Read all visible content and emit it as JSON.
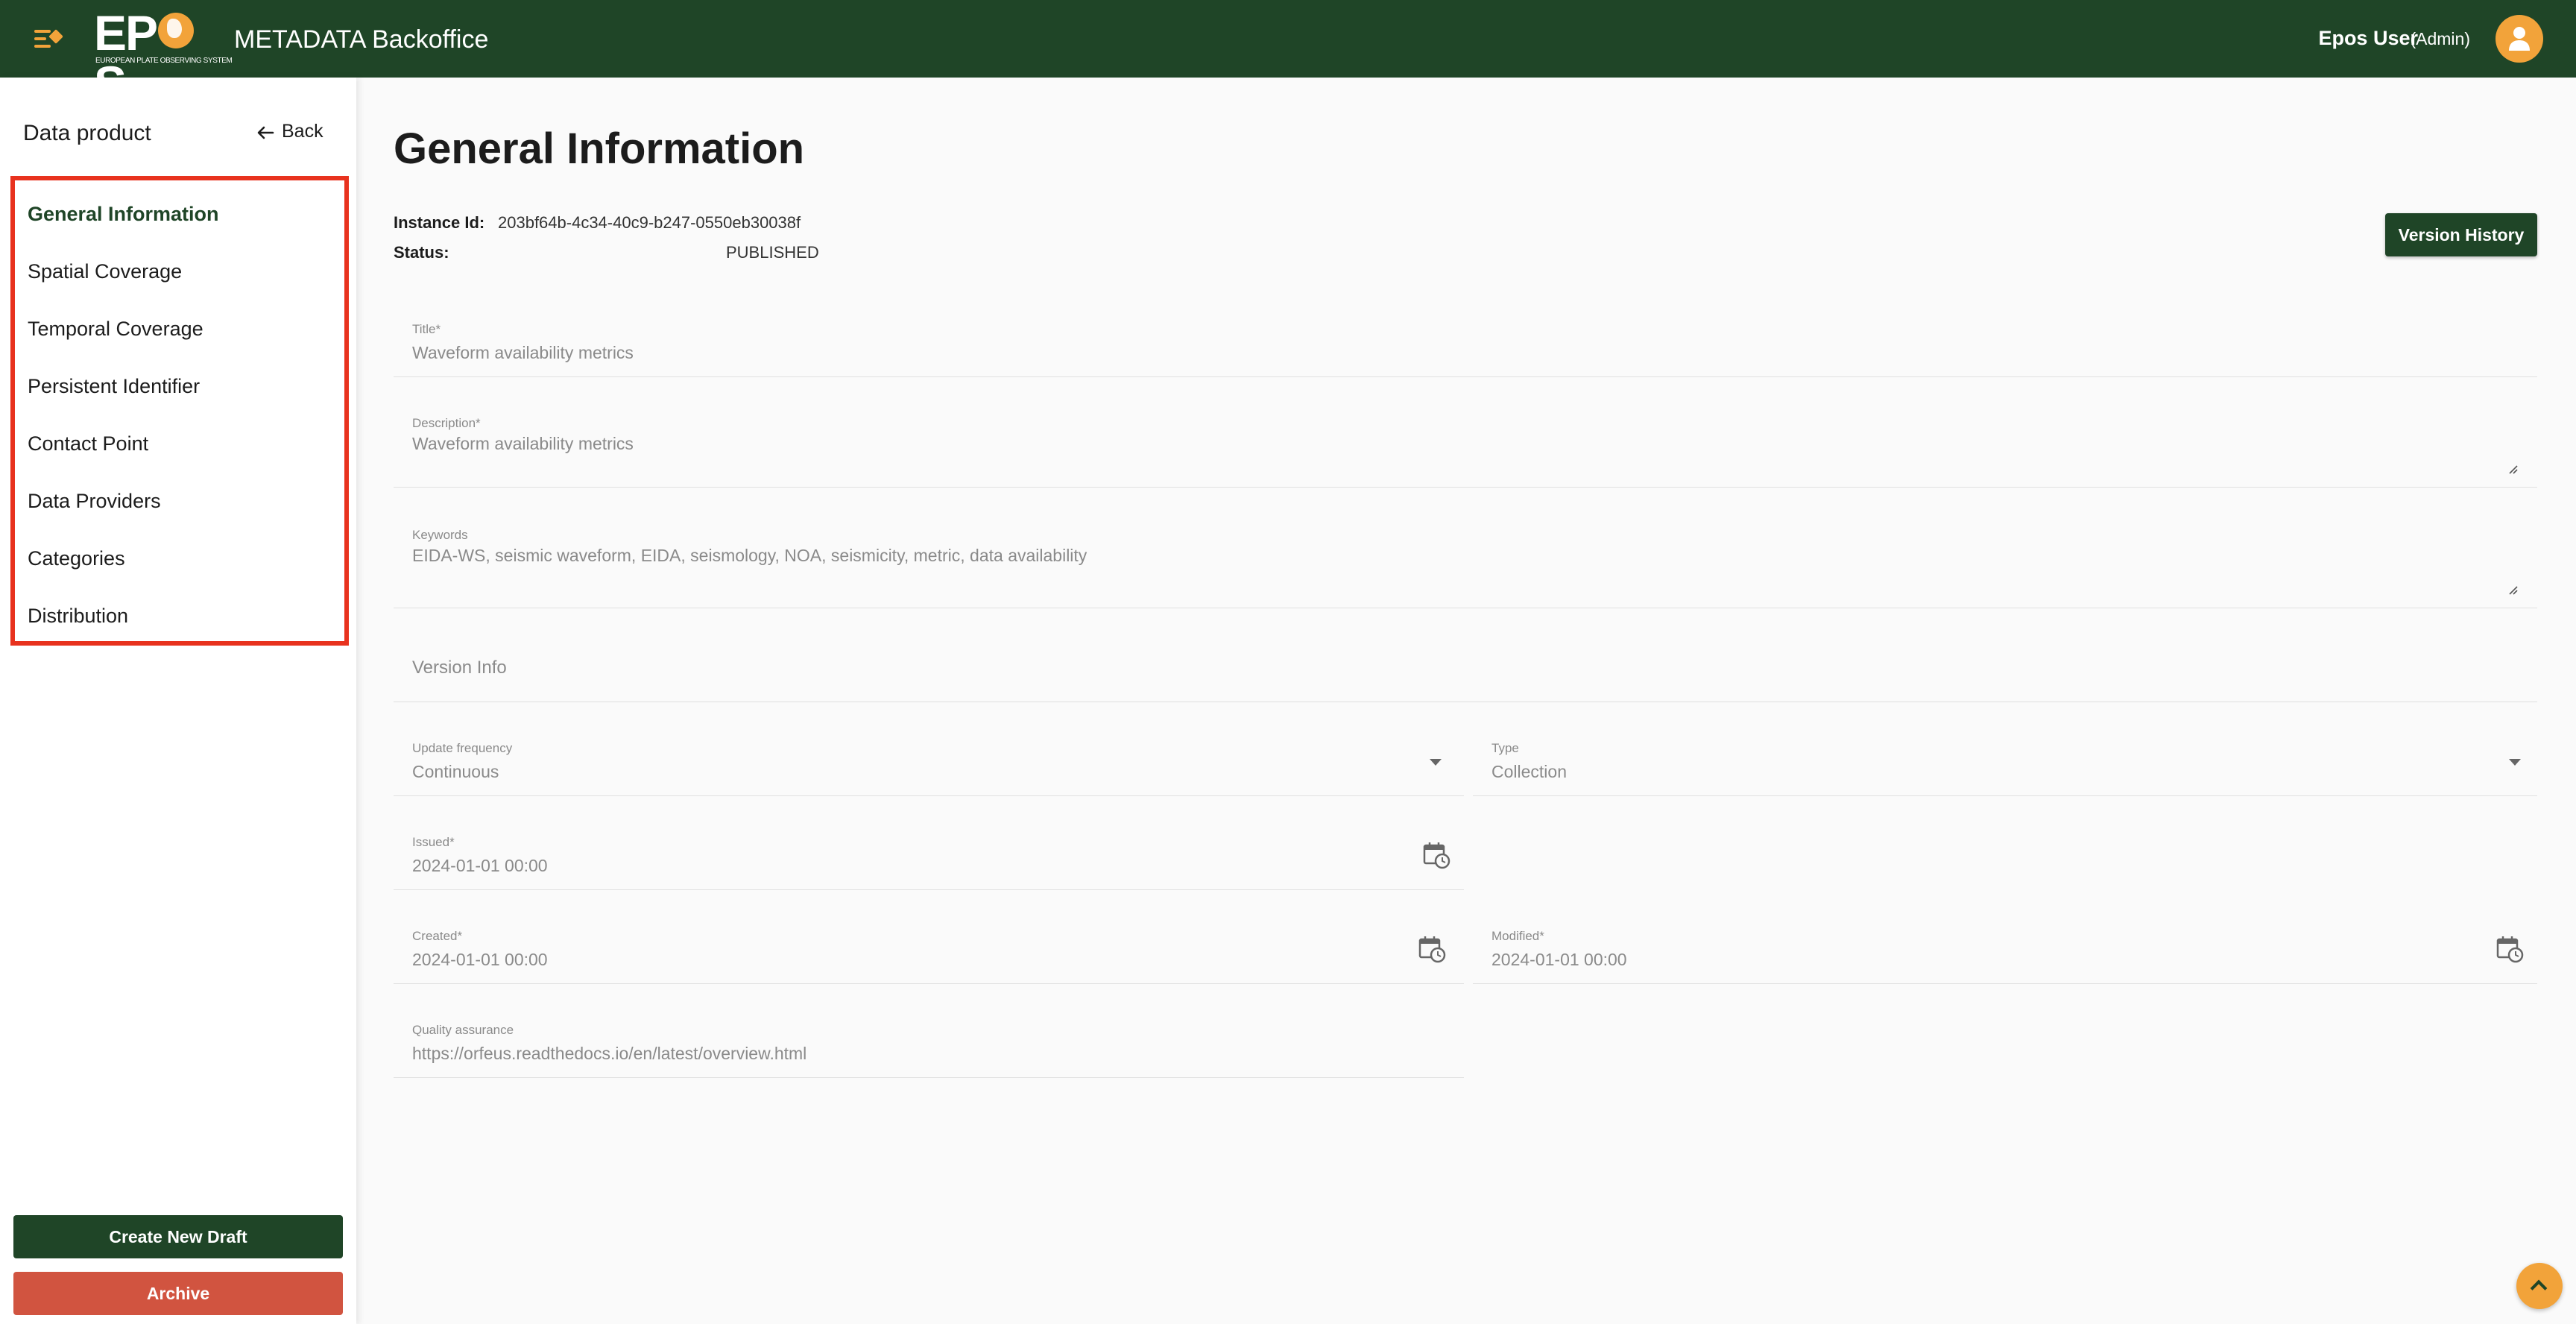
{
  "header": {
    "logo_text": "EPOS",
    "logo_subtitle": "EUROPEAN PLATE OBSERVING SYSTEM",
    "app_title": "METADATA Backoffice",
    "user_name": "Epos User",
    "user_role": "(Admin)"
  },
  "sidebar": {
    "title": "Data product",
    "back_label": "Back",
    "items": [
      {
        "label": "General Information",
        "active": true
      },
      {
        "label": "Spatial Coverage"
      },
      {
        "label": "Temporal Coverage"
      },
      {
        "label": "Persistent Identifier"
      },
      {
        "label": "Contact Point"
      },
      {
        "label": "Data Providers"
      },
      {
        "label": "Categories"
      },
      {
        "label": "Distribution"
      }
    ],
    "create_draft_label": "Create New Draft",
    "archive_label": "Archive"
  },
  "main": {
    "title": "General Information",
    "instance_id_label": "Instance Id:",
    "instance_id": "203bf64b-4c34-40c9-b247-0550eb30038f",
    "status_label": "Status:",
    "status": "PUBLISHED",
    "version_history_label": "Version History",
    "fields": {
      "title": {
        "label": "Title*",
        "value": "Waveform availability metrics"
      },
      "description": {
        "label": "Description*",
        "value": "Waveform availability metrics"
      },
      "keywords": {
        "label": "Keywords",
        "value": "EIDA-WS, seismic waveform, EIDA, seismology, NOA, seismicity, metric, data availability"
      },
      "version_info": {
        "placeholder": "Version Info"
      },
      "update_frequency": {
        "label": "Update frequency",
        "value": "Continuous"
      },
      "type": {
        "label": "Type",
        "value": "Collection"
      },
      "issued": {
        "label": "Issued*",
        "value": "2024-01-01 00:00"
      },
      "created": {
        "label": "Created*",
        "value": "2024-01-01 00:00"
      },
      "modified": {
        "label": "Modified*",
        "value": "2024-01-01 00:00"
      },
      "quality_assurance": {
        "label": "Quality assurance",
        "value": "https://orfeus.readthedocs.io/en/latest/overview.html"
      }
    }
  },
  "colors": {
    "primary": "#1f4527",
    "accent": "#f2a33a",
    "danger": "#d15440",
    "highlight_border": "#e8321e"
  },
  "icons": [
    "menu-collapse-icon",
    "user-icon",
    "arrow-left-icon",
    "dropdown-arrow-icon",
    "calendar-clock-icon",
    "chevron-up-icon",
    "resize-handle-icon"
  ]
}
